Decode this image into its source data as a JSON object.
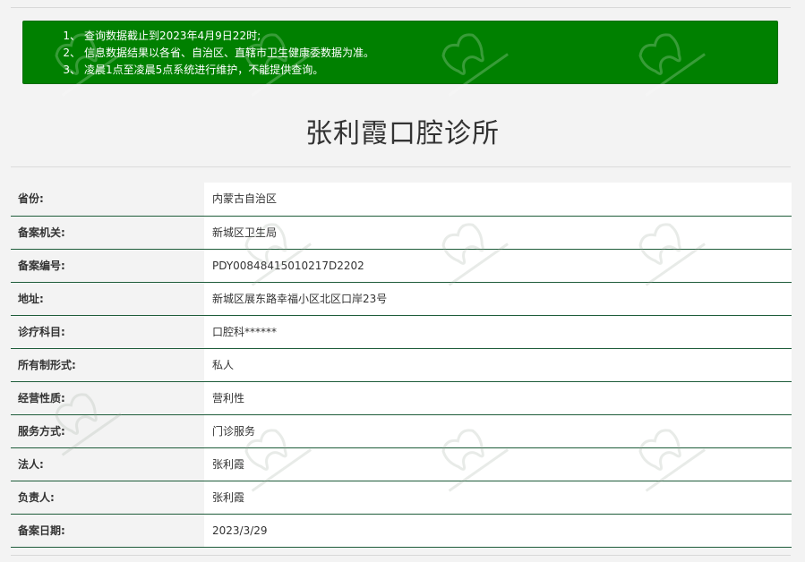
{
  "notice": {
    "lines": [
      {
        "num": "1、",
        "text": "查询数据截止到2023年4月9日22时;"
      },
      {
        "num": "2、",
        "text": "信息数据结果以各省、自治区、直辖市卫生健康委数据为准。"
      },
      {
        "num": "3、",
        "text": "凌晨1点至凌晨5点系统进行维护，不能提供查询。"
      }
    ]
  },
  "clinic": {
    "title": "张利霞口腔诊所"
  },
  "fields": [
    {
      "label": "省份:",
      "value": "内蒙古自治区"
    },
    {
      "label": "备案机关:",
      "value": "新城区卫生局"
    },
    {
      "label": "备案编号:",
      "value": "PDY00848415010217D2202"
    },
    {
      "label": "地址:",
      "value": "新城区展东路幸福小区北区口岸23号"
    },
    {
      "label": "诊疗科目:",
      "value": "口腔科******"
    },
    {
      "label": "所有制形式:",
      "value": "私人"
    },
    {
      "label": "经营性质:",
      "value": "营利性"
    },
    {
      "label": "服务方式:",
      "value": "门诊服务"
    },
    {
      "label": "法人:",
      "value": "张利霞"
    },
    {
      "label": "负责人:",
      "value": "张利霞"
    },
    {
      "label": "备案日期:",
      "value": "2023/3/29"
    }
  ],
  "colors": {
    "notice_bg": "#008000",
    "row_border": "#1e5c3a",
    "page_bg": "#f3f3f3"
  }
}
